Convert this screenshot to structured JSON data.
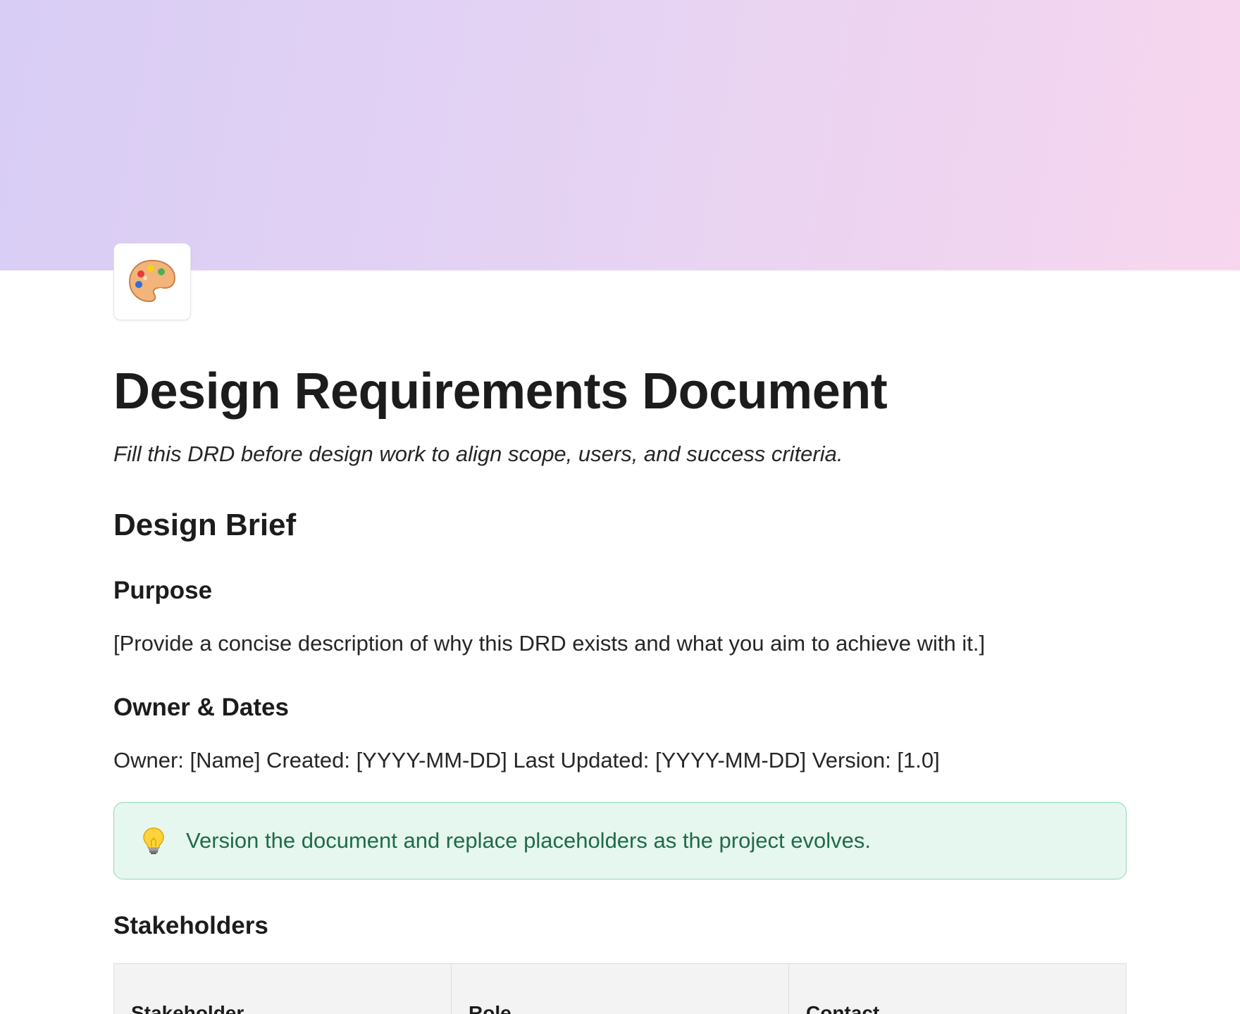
{
  "cover": {
    "gradient_start": "#d8cdf5",
    "gradient_end": "#f7d6ee"
  },
  "page_icon": "artist-palette-icon",
  "title": "Design Requirements Document",
  "subtitle": "Fill this DRD before design work to align scope, users, and success criteria.",
  "sections": {
    "design_brief": {
      "heading": "Design Brief",
      "purpose": {
        "heading": "Purpose",
        "text": "[Provide a concise description of why this DRD exists and what you aim to achieve with it.]"
      },
      "owner_dates": {
        "heading": "Owner & Dates",
        "text": "Owner: [Name] Created: [YYYY-MM-DD] Last Updated: [YYYY-MM-DD] Version: [1.0]"
      },
      "callout": {
        "icon": "lightbulb-icon",
        "text": "Version the document and replace placeholders as the project evolves.",
        "bg_color": "#e6f7ef",
        "border_color": "#8fd8b6",
        "text_color": "#1f6b4a"
      }
    },
    "stakeholders": {
      "heading": "Stakeholders",
      "columns": [
        "Stakeholder",
        "Role",
        "Contact"
      ]
    }
  }
}
